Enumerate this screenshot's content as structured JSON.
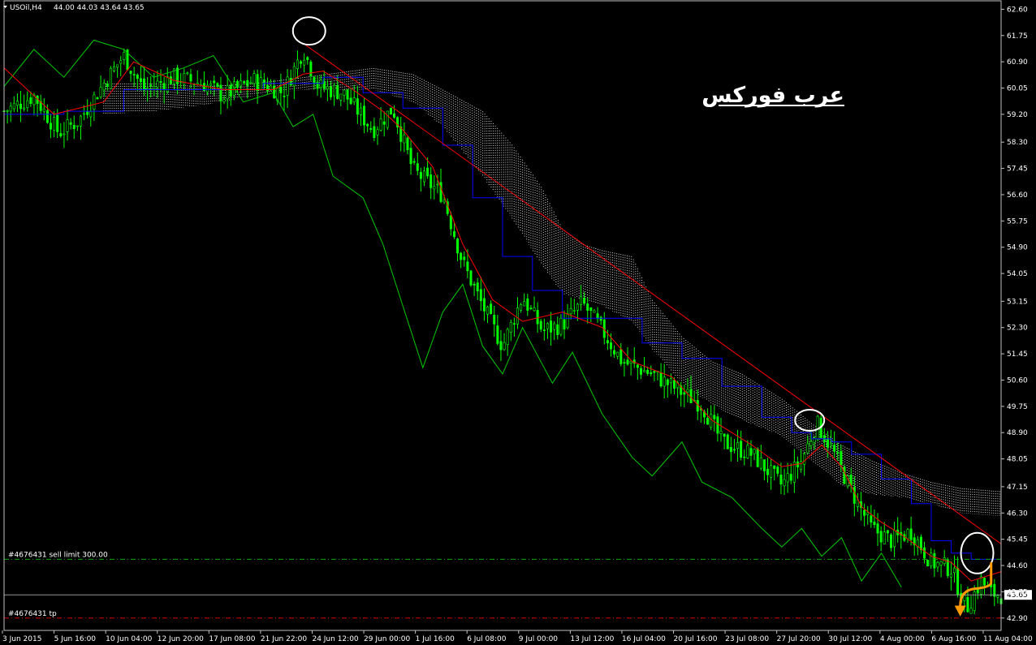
{
  "header": {
    "symbol": "USOil,H4",
    "ohlc": "44.00 44.03 43.64 43.65"
  },
  "watermark": "عرب فوركس",
  "colors": {
    "background": "#000000",
    "bull_candle": "#00ff00",
    "bear_candle": "#00ff00",
    "tenkan": "#ff0000",
    "kijun": "#0000ff",
    "chikou": "#00cc00",
    "kumo": "#ffffff",
    "trendline": "#ff0000",
    "sell_limit_line": "#00aa00",
    "tp_line": "#cc0000",
    "price_line": "#aaaaaa",
    "arrow": "#ff9900",
    "circle": "#ffffff"
  },
  "orders": {
    "sell_limit_label": "#4676431 sell limit 300.00",
    "sell_limit_price": 44.8,
    "tp_label": "#4676431 tp",
    "tp_price": 42.9
  },
  "current_price": {
    "label": "43.65",
    "value": 43.65
  },
  "chart_data": {
    "type": "candlestick",
    "title": "",
    "y_ticks": [
      "62.60",
      "61.75",
      "60.90",
      "60.05",
      "59.20",
      "58.30",
      "57.45",
      "56.60",
      "55.75",
      "54.90",
      "54.05",
      "53.15",
      "52.30",
      "51.45",
      "50.60",
      "49.75",
      "48.90",
      "48.05",
      "47.15",
      "46.30",
      "45.45",
      "44.60",
      "43.75",
      "42.90"
    ],
    "ylim": [
      42.5,
      62.9
    ],
    "x_ticks": [
      "3 Jun 2015",
      "5 Jun 16:00",
      "10 Jun 04:00",
      "12 Jun 20:00",
      "17 Jun 08:00",
      "21 Jun 22:00",
      "24 Jun 12:00",
      "29 Jun 00:00",
      "1 Jul 16:00",
      "6 Jul 08:00",
      "9 Jul 00:00",
      "13 Jul 12:00",
      "16 Jul 04:00",
      "20 Jul 16:00",
      "23 Jul 08:00",
      "27 Jul 20:00",
      "30 Jul 12:00",
      "4 Aug 00:00",
      "6 Aug 16:00",
      "11 Aug 04:00"
    ],
    "price_keypoints": [
      [
        0,
        59.3
      ],
      [
        0.03,
        59.8
      ],
      [
        0.055,
        58.6
      ],
      [
        0.075,
        59.0
      ],
      [
        0.1,
        60.2
      ],
      [
        0.12,
        61.1
      ],
      [
        0.14,
        60.0
      ],
      [
        0.17,
        60.4
      ],
      [
        0.2,
        60.2
      ],
      [
        0.22,
        59.8
      ],
      [
        0.25,
        60.3
      ],
      [
        0.28,
        59.9
      ],
      [
        0.3,
        61.3
      ],
      [
        0.315,
        60.1
      ],
      [
        0.34,
        59.9
      ],
      [
        0.37,
        58.7
      ],
      [
        0.39,
        59.4
      ],
      [
        0.41,
        57.4
      ],
      [
        0.44,
        56.6
      ],
      [
        0.46,
        54.4
      ],
      [
        0.48,
        53.0
      ],
      [
        0.5,
        51.7
      ],
      [
        0.52,
        53.3
      ],
      [
        0.54,
        52.2
      ],
      [
        0.56,
        52.4
      ],
      [
        0.58,
        53.1
      ],
      [
        0.6,
        52.2
      ],
      [
        0.62,
        51.2
      ],
      [
        0.65,
        50.8
      ],
      [
        0.68,
        50.2
      ],
      [
        0.7,
        49.8
      ],
      [
        0.72,
        48.6
      ],
      [
        0.75,
        48.2
      ],
      [
        0.78,
        47.2
      ],
      [
        0.8,
        48.0
      ],
      [
        0.815,
        49.2
      ],
      [
        0.83,
        48.4
      ],
      [
        0.85,
        47.0
      ],
      [
        0.87,
        45.8
      ],
      [
        0.89,
        45.4
      ],
      [
        0.91,
        45.7
      ],
      [
        0.93,
        44.7
      ],
      [
        0.95,
        44.5
      ],
      [
        0.965,
        43.2
      ],
      [
        0.98,
        44.1
      ],
      [
        0.99,
        43.7
      ],
      [
        1,
        43.65
      ]
    ],
    "tenkan_keypoints": [
      [
        0,
        60.7
      ],
      [
        0.05,
        59.2
      ],
      [
        0.1,
        59.6
      ],
      [
        0.13,
        60.9
      ],
      [
        0.17,
        60.3
      ],
      [
        0.22,
        60.0
      ],
      [
        0.27,
        60.0
      ],
      [
        0.3,
        60.5
      ],
      [
        0.32,
        60.6
      ],
      [
        0.35,
        60.0
      ],
      [
        0.38,
        59.3
      ],
      [
        0.4,
        58.7
      ],
      [
        0.43,
        57.5
      ],
      [
        0.46,
        55.0
      ],
      [
        0.49,
        53.2
      ],
      [
        0.52,
        52.5
      ],
      [
        0.56,
        52.8
      ],
      [
        0.6,
        52.3
      ],
      [
        0.63,
        51.2
      ],
      [
        0.67,
        50.7
      ],
      [
        0.71,
        49.3
      ],
      [
        0.75,
        48.5
      ],
      [
        0.78,
        47.8
      ],
      [
        0.8,
        47.9
      ],
      [
        0.82,
        48.5
      ],
      [
        0.84,
        47.8
      ],
      [
        0.86,
        46.5
      ],
      [
        0.88,
        46.0
      ],
      [
        0.9,
        45.6
      ],
      [
        0.93,
        44.9
      ],
      [
        0.95,
        44.7
      ],
      [
        0.97,
        44.1
      ],
      [
        1,
        44.4
      ]
    ],
    "kijun_keypoints": [
      [
        0,
        59.2
      ],
      [
        0.06,
        59.3
      ],
      [
        0.12,
        60.0
      ],
      [
        0.2,
        60.0
      ],
      [
        0.26,
        60.2
      ],
      [
        0.32,
        60.4
      ],
      [
        0.36,
        59.9
      ],
      [
        0.4,
        59.4
      ],
      [
        0.44,
        58.2
      ],
      [
        0.47,
        56.5
      ],
      [
        0.5,
        54.6
      ],
      [
        0.53,
        53.5
      ],
      [
        0.56,
        52.6
      ],
      [
        0.6,
        52.6
      ],
      [
        0.64,
        51.8
      ],
      [
        0.68,
        51.3
      ],
      [
        0.72,
        50.4
      ],
      [
        0.76,
        49.4
      ],
      [
        0.79,
        48.9
      ],
      [
        0.81,
        48.7
      ],
      [
        0.83,
        48.6
      ],
      [
        0.85,
        48.2
      ],
      [
        0.88,
        47.4
      ],
      [
        0.91,
        46.6
      ],
      [
        0.93,
        45.4
      ],
      [
        0.95,
        45.0
      ],
      [
        0.97,
        44.8
      ],
      [
        1,
        44.8
      ]
    ],
    "chikou_keypoints": [
      [
        0,
        60.1
      ],
      [
        0.03,
        61.3
      ],
      [
        0.06,
        60.4
      ],
      [
        0.09,
        61.6
      ],
      [
        0.12,
        61.3
      ],
      [
        0.15,
        60.4
      ],
      [
        0.18,
        60.7
      ],
      [
        0.21,
        61.1
      ],
      [
        0.24,
        59.6
      ],
      [
        0.27,
        59.9
      ],
      [
        0.29,
        58.8
      ],
      [
        0.31,
        59.2
      ],
      [
        0.33,
        57.2
      ],
      [
        0.36,
        56.5
      ],
      [
        0.38,
        55.0
      ],
      [
        0.4,
        53.0
      ],
      [
        0.42,
        51.0
      ],
      [
        0.44,
        52.8
      ],
      [
        0.46,
        53.7
      ],
      [
        0.48,
        51.7
      ],
      [
        0.5,
        50.8
      ],
      [
        0.52,
        52.3
      ],
      [
        0.55,
        50.5
      ],
      [
        0.57,
        51.5
      ],
      [
        0.6,
        49.5
      ],
      [
        0.63,
        48.1
      ],
      [
        0.65,
        47.5
      ],
      [
        0.68,
        48.6
      ],
      [
        0.7,
        47.3
      ],
      [
        0.73,
        46.8
      ],
      [
        0.76,
        45.8
      ],
      [
        0.78,
        45.2
      ],
      [
        0.8,
        45.8
      ],
      [
        0.82,
        44.9
      ],
      [
        0.84,
        45.5
      ],
      [
        0.86,
        44.1
      ],
      [
        0.88,
        45.0
      ],
      [
        0.9,
        43.9
      ]
    ],
    "kumo_upper_keypoints": [
      [
        0.1,
        60.2
      ],
      [
        0.15,
        60.2
      ],
      [
        0.2,
        60.1
      ],
      [
        0.25,
        60.2
      ],
      [
        0.3,
        60.4
      ],
      [
        0.37,
        60.7
      ],
      [
        0.41,
        60.5
      ],
      [
        0.44,
        60.0
      ],
      [
        0.48,
        59.3
      ],
      [
        0.51,
        58.2
      ],
      [
        0.54,
        56.8
      ],
      [
        0.56,
        55.5
      ],
      [
        0.58,
        55.0
      ],
      [
        0.6,
        54.8
      ],
      [
        0.63,
        54.6
      ],
      [
        0.65,
        53.2
      ],
      [
        0.68,
        52.0
      ],
      [
        0.71,
        51.2
      ],
      [
        0.74,
        50.8
      ],
      [
        0.78,
        50.0
      ],
      [
        0.81,
        49.2
      ],
      [
        0.84,
        48.5
      ],
      [
        0.87,
        48.0
      ],
      [
        0.9,
        47.6
      ],
      [
        0.93,
        47.3
      ],
      [
        0.96,
        47.1
      ],
      [
        1,
        47.0
      ]
    ],
    "kumo_lower_keypoints": [
      [
        0.1,
        59.2
      ],
      [
        0.15,
        59.3
      ],
      [
        0.2,
        59.5
      ],
      [
        0.25,
        59.8
      ],
      [
        0.3,
        60.0
      ],
      [
        0.37,
        60.0
      ],
      [
        0.41,
        59.6
      ],
      [
        0.44,
        58.8
      ],
      [
        0.48,
        57.2
      ],
      [
        0.51,
        55.8
      ],
      [
        0.54,
        54.3
      ],
      [
        0.56,
        53.4
      ],
      [
        0.58,
        53.2
      ],
      [
        0.6,
        53.0
      ],
      [
        0.63,
        52.5
      ],
      [
        0.65,
        51.6
      ],
      [
        0.68,
        50.5
      ],
      [
        0.71,
        49.8
      ],
      [
        0.74,
        49.3
      ],
      [
        0.78,
        48.8
      ],
      [
        0.81,
        48.0
      ],
      [
        0.84,
        47.2
      ],
      [
        0.87,
        46.9
      ],
      [
        0.9,
        46.8
      ],
      [
        0.93,
        46.6
      ],
      [
        0.96,
        46.3
      ],
      [
        1,
        46.2
      ]
    ],
    "trendline": {
      "from": [
        0.3,
        61.5
      ],
      "to": [
        1.0,
        45.3
      ]
    },
    "circled_points": [
      {
        "t": 0.306,
        "price": 61.9
      },
      {
        "t": 0.808,
        "price": 49.3
      },
      {
        "t": 0.976,
        "price": 45.0
      }
    ]
  }
}
